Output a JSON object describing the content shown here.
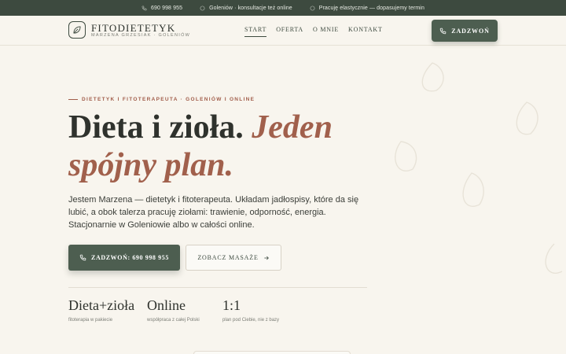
{
  "topbar": {
    "phone": "690 998 955",
    "location": "Goleniów · konsultacje też online",
    "hours": "Pracuję elastycznie — dopasujemy termin"
  },
  "header": {
    "brand": "FITODIETETYK",
    "brand_sub": "MARZENA GRZESIAK · GOLENIÓW",
    "nav": [
      {
        "label": "START",
        "active": true
      },
      {
        "label": "OFERTA",
        "active": false
      },
      {
        "label": "O MNIE",
        "active": false
      },
      {
        "label": "KONTAKT",
        "active": false
      }
    ],
    "call_label": "ZADZWOŃ"
  },
  "hero": {
    "eyebrow": "DIETETYK I FITOTERAPEUTA · GOLENIÓW I ONLINE",
    "headline_plain": "Dieta i zioła.",
    "headline_accent": "Jeden spójny plan.",
    "lead": "Jestem Marzena — dietetyk i fitoterapeuta. Układam jadłospisy, które da się lubić, a obok talerza pracuję ziołami: trawienie, odporność, energia. Stacjonarnie w Goleniowie albo w całości online.",
    "primary_button": "ZADZWOŃ: 690 998 955",
    "secondary_button": "ZOBACZ MASAŻE"
  },
  "stats": [
    {
      "value": "Dieta+zioła",
      "label": "fitoterapia w pakiecie"
    },
    {
      "value": "Online",
      "label": "współpraca z całej Polski"
    },
    {
      "value": "1:1",
      "label": "plan pod Ciebie, nie z bazy"
    }
  ],
  "colors": {
    "primary": "#4d5e50",
    "topbar": "#3d4a3f",
    "accent": "#a1604c",
    "background": "#f8f5ee"
  },
  "icons": [
    "phone-icon",
    "location-icon",
    "clock-icon",
    "leaf-icon",
    "arrow-right-icon"
  ]
}
